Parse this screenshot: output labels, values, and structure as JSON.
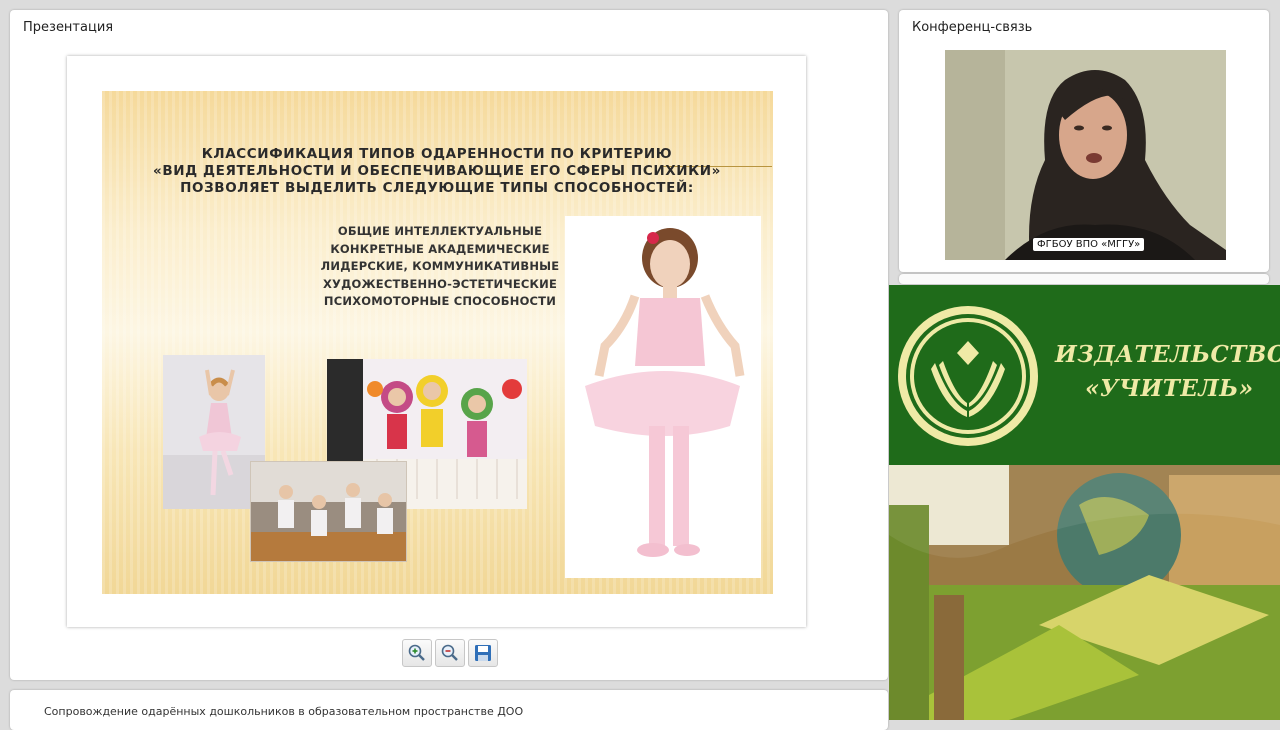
{
  "presentation": {
    "title": "Презентация",
    "slide": {
      "heading_lines": [
        "КЛАССИФИКАЦИЯ ТИПОВ ОДАРЕННОСТИ ПО КРИТЕРИЮ",
        "«ВИД ДЕЯТЕЛЬНОСТИ И ОБЕСПЕЧИВАЮЩИЕ ЕГО СФЕРЫ ПСИХИКИ»",
        "ПОЗВОЛЯЕТ ВЫДЕЛИТЬ СЛЕДУЮЩИЕ ТИПЫ СПОСОБНОСТЕЙ:"
      ],
      "list_items": [
        "ОБЩИЕ ИНТЕЛЛЕКТУАЛЬНЫЕ",
        "КОНКРЕТНЫЕ АКАДЕМИЧЕСКИЕ",
        "ЛИДЕРСКИЕ, КОММУНИКАТИВНЫЕ",
        "ХУДОЖЕСТВЕННО-ЭСТЕТИЧЕСКИЕ",
        "ПСИХОМОТОРНЫЕ СПОСОБНОСТИ"
      ]
    },
    "toolbar": {
      "zoom_in_icon": "zoom-in-icon",
      "zoom_out_icon": "zoom-out-icon",
      "save_icon": "save-icon"
    }
  },
  "conference": {
    "title": "Конференц-связь",
    "camera_caption": "ФГБОУ ВПО «МГГУ»"
  },
  "publisher": {
    "line1": "ИЗДАТЕЛЬСТВО",
    "line2": "«УЧИТЕЛЬ»",
    "colors": {
      "banner": "#1f6b1a",
      "text": "#efeaa6"
    }
  },
  "footer": {
    "text": "Сопровождение одарённых дошкольников в образовательном пространстве ДОО"
  }
}
